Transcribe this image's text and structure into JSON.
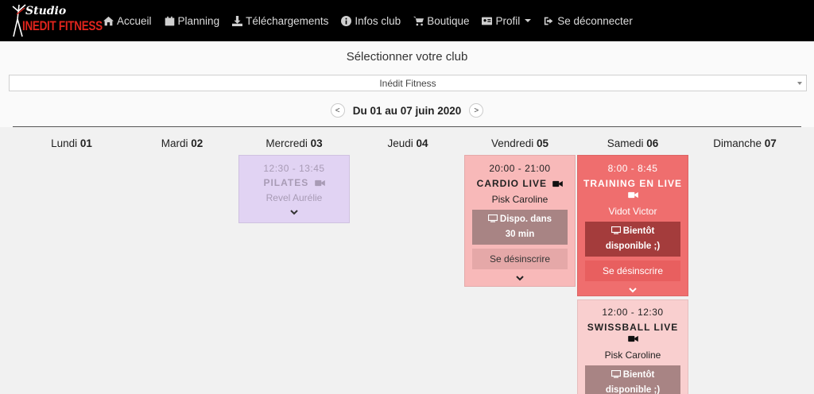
{
  "brand": {
    "line1": "Studio",
    "line2": "INEDIT FITNESS"
  },
  "nav": {
    "items": [
      {
        "label": "Accueil",
        "icon": "home-icon"
      },
      {
        "label": "Planning",
        "icon": "calendar-icon"
      },
      {
        "label": "Téléchargements",
        "icon": "download-icon"
      },
      {
        "label": "Infos club",
        "icon": "info-circle-icon"
      },
      {
        "label": "Boutique",
        "icon": "shopping-cart-icon"
      },
      {
        "label": "Profil",
        "icon": "id-card-icon"
      },
      {
        "label": "Se déconnecter",
        "icon": "sign-out-icon"
      }
    ]
  },
  "club": {
    "title": "Sélectionner votre club",
    "selected": "Inédit Fitness"
  },
  "week": {
    "label": "Du 01 au 07 juin 2020",
    "prev": "<",
    "next": ">"
  },
  "days": [
    {
      "name": "Lundi",
      "num": "01"
    },
    {
      "name": "Mardi",
      "num": "02"
    },
    {
      "name": "Mercredi",
      "num": "03"
    },
    {
      "name": "Jeudi",
      "num": "04"
    },
    {
      "name": "Vendredi",
      "num": "05"
    },
    {
      "name": "Samedi",
      "num": "06"
    },
    {
      "name": "Dimanche",
      "num": "07"
    }
  ],
  "classes": {
    "pilates": {
      "time": "12:30 - 13:45",
      "name": "PILATES",
      "coach": "Revel Aurélie"
    },
    "cardio": {
      "time": "20:00 - 21:00",
      "name": "CARDIO LIVE",
      "coach": "Pisk Caroline",
      "status_line1": "Dispo. dans",
      "status_line2": "30 min",
      "unsub": "Se désinscrire"
    },
    "training": {
      "time": "8:00 - 8:45",
      "name": "TRAINING EN LIVE",
      "coach": "Vidot Victor",
      "status_line1": "Bientôt",
      "status_line2": "disponible ;)",
      "unsub": "Se désinscrire"
    },
    "swissball": {
      "time": "12:00 - 12:30",
      "name": "SWISSBALL LIVE",
      "coach": "Pisk Caroline",
      "status_line1": "Bientôt",
      "status_line2": "disponible ;)"
    }
  },
  "colors": {
    "navbar": "#000000",
    "pilates_bg": "#e1d3f3",
    "cardio_bg": "#f8b9b9",
    "training_bg": "#ef6e6e",
    "swissball_bg": "#f9cfcf",
    "status_btn": "#a88484",
    "status_btn_dark": "#a43c3c"
  }
}
